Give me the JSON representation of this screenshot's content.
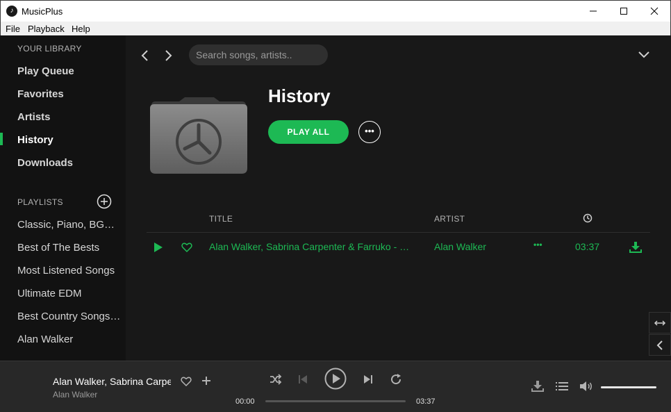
{
  "window": {
    "title": "MusicPlus",
    "app_icon": "music-note-icon",
    "controls": [
      "minimize-icon",
      "maximize-icon",
      "close-icon"
    ]
  },
  "menu": {
    "items": [
      "File",
      "Playback",
      "Help"
    ]
  },
  "sidebar": {
    "library_header": "YOUR LIBRARY",
    "library_items": [
      {
        "label": "Play Queue"
      },
      {
        "label": "Favorites"
      },
      {
        "label": "Artists"
      },
      {
        "label": "History",
        "active": true
      },
      {
        "label": "Downloads"
      }
    ],
    "playlists_header": "PLAYLISTS",
    "add_playlist_icon": "plus-circle-icon",
    "playlists": [
      "Classic, Piano, BGM Collection",
      "Best of The Bests",
      "Most Listened Songs",
      "Ultimate EDM",
      "Best Country Songs Ever",
      "Alan Walker"
    ]
  },
  "main": {
    "search": {
      "placeholder": "Search songs, artists.."
    },
    "page_title": "History",
    "cover_icon": "history-folder-icon",
    "play_all_label": "PLAY ALL",
    "more_label": "•••",
    "columns": {
      "title": "TITLE",
      "artist": "ARTIST",
      "duration_icon": "clock-icon"
    },
    "tracks": [
      {
        "title": "Alan Walker, Sabrina Carpenter & Farruko - On My Way",
        "artist": "Alan Walker",
        "more": "•••",
        "duration": "03:37"
      }
    ]
  },
  "player": {
    "now_playing": {
      "title": "Alan Walker, Sabrina Carpenter & Farruko",
      "artist": "Alan Walker"
    },
    "elapsed": "00:00",
    "total": "03:37",
    "progress": 0.0,
    "volume": 1.0
  },
  "colors": {
    "accent": "#1db954",
    "sidebar_bg": "#121212",
    "main_bg": "#181818",
    "player_bg": "#282828"
  }
}
